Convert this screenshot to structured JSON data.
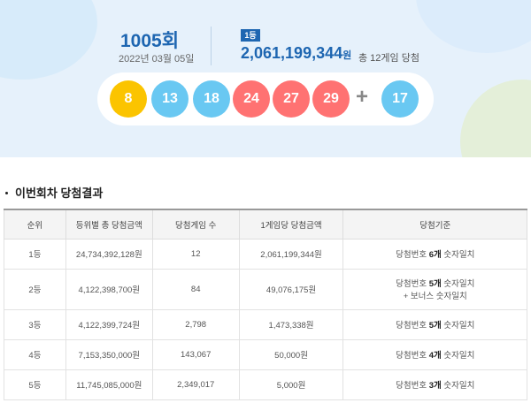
{
  "draw": {
    "round_number": "1005",
    "round_suffix": "회",
    "date": "2022년 03월 05일",
    "first_rank_badge": "1등",
    "first_prize_amount": "2,061,199,344",
    "won_unit": "원",
    "winners_text": "총 12게임 당첨"
  },
  "balls": [
    {
      "number": "8",
      "color": "#fbc400"
    },
    {
      "number": "13",
      "color": "#69c8f2"
    },
    {
      "number": "18",
      "color": "#69c8f2"
    },
    {
      "number": "24",
      "color": "#ff7272"
    },
    {
      "number": "27",
      "color": "#ff7272"
    },
    {
      "number": "29",
      "color": "#ff7272"
    }
  ],
  "plus": "+",
  "bonus_ball": {
    "number": "17",
    "color": "#69c8f2"
  },
  "results": {
    "title": "이번회차 당첨결과",
    "headers": [
      "순위",
      "등위별 총 당첨금액",
      "당첨게임 수",
      "1게임당 당첨금액",
      "당첨기준"
    ],
    "rows": [
      {
        "rank": "1등",
        "total": "24,734,392,128원",
        "games": "12",
        "per_game": "2,061,199,344원",
        "crit_pre": "당첨번호 ",
        "crit_bold": "6개",
        "crit_post": " 숫자일치",
        "crit_line2": ""
      },
      {
        "rank": "2등",
        "total": "4,122,398,700원",
        "games": "84",
        "per_game": "49,076,175원",
        "crit_pre": "당첨번호 ",
        "crit_bold": "5개",
        "crit_post": " 숫자일치",
        "crit_line2": "+ 보너스 숫자일치"
      },
      {
        "rank": "3등",
        "total": "4,122,399,724원",
        "games": "2,798",
        "per_game": "1,473,338원",
        "crit_pre": "당첨번호 ",
        "crit_bold": "5개",
        "crit_post": " 숫자일치",
        "crit_line2": ""
      },
      {
        "rank": "4등",
        "total": "7,153,350,000원",
        "games": "143,067",
        "per_game": "50,000원",
        "crit_pre": "당첨번호 ",
        "crit_bold": "4개",
        "crit_post": " 숫자일치",
        "crit_line2": ""
      },
      {
        "rank": "5등",
        "total": "11,745,085,000원",
        "games": "2,349,017",
        "per_game": "5,000원",
        "crit_pre": "당첨번호 ",
        "crit_bold": "3개",
        "crit_post": " 숫자일치",
        "crit_line2": ""
      }
    ]
  }
}
